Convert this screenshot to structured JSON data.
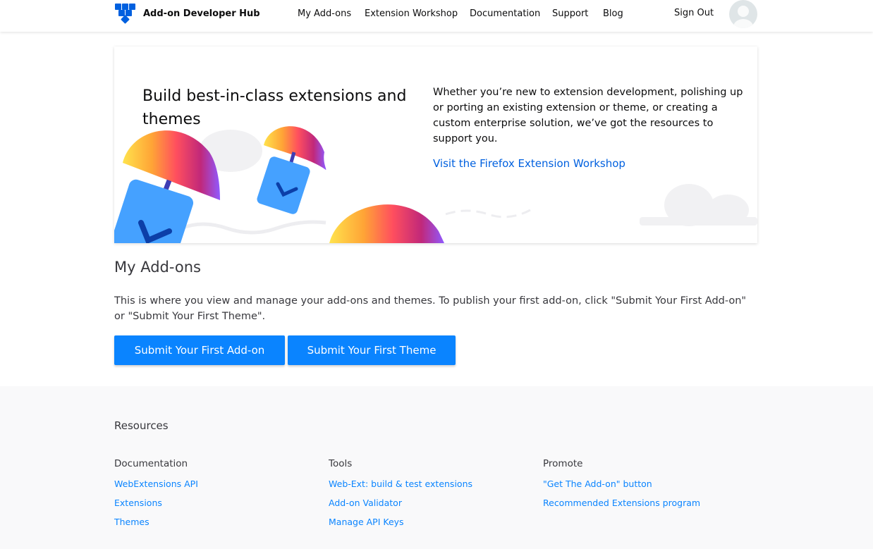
{
  "header": {
    "brand": "Add-on Developer Hub",
    "nav": [
      "My Add-ons",
      "Extension Workshop",
      "Documentation",
      "Support",
      "Blog"
    ],
    "sign_out": "Sign Out"
  },
  "hero": {
    "title": "Build best-in-class extensions and themes",
    "text": "Whether you’re new to extension development, polishing up or porting an existing extension or theme, or creating a custom enterprise solution, we’ve got the resources to support you.",
    "link": "Visit the Firefox Extension Workshop"
  },
  "main": {
    "title": "My Add-ons",
    "intro": "This is where you view and manage your add-ons and themes. To publish your first add-on, click \"Submit Your First Add-on\" or \"Submit Your First Theme\".",
    "submit_addon": "Submit Your First Add-on",
    "submit_theme": "Submit Your First Theme"
  },
  "footer": {
    "title": "Resources",
    "columns": [
      {
        "heading": "Documentation",
        "links": [
          "WebExtensions API",
          "Extensions",
          "Themes"
        ]
      },
      {
        "heading": "Tools",
        "links": [
          "Web-Ext: build & test extensions",
          "Add-on Validator",
          "Manage API Keys"
        ]
      },
      {
        "heading": "Promote",
        "links": [
          "\"Get The Add-on\" button",
          "Recommended Extensions program"
        ]
      }
    ]
  },
  "colors": {
    "accent": "#0a84ff",
    "link": "#0060df",
    "footer_bg": "#f9f9fa"
  }
}
